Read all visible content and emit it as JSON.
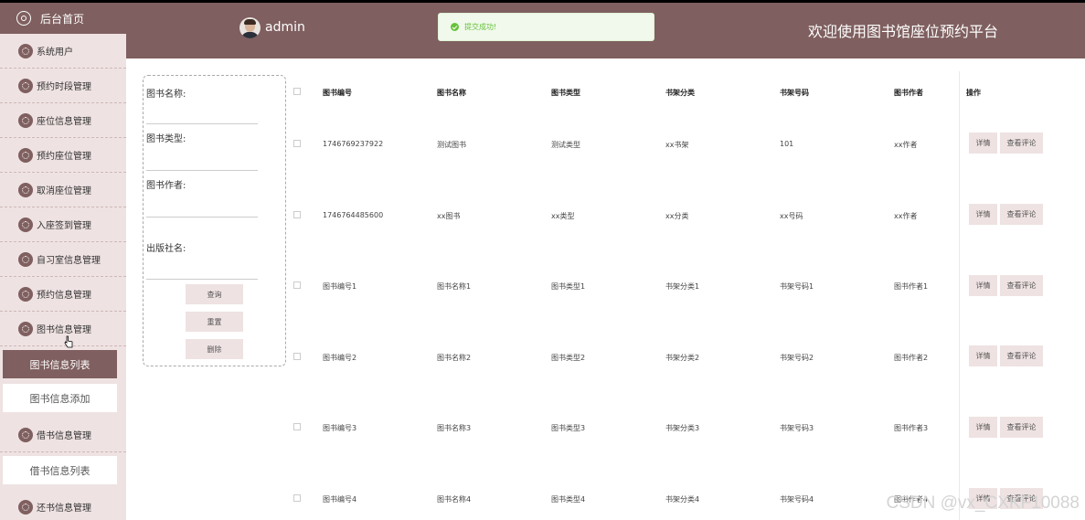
{
  "sidebar": {
    "home": "后台首页",
    "items": [
      {
        "label": "系统用户"
      },
      {
        "label": "预约时段管理"
      },
      {
        "label": "座位信息管理"
      },
      {
        "label": "预约座位管理"
      },
      {
        "label": "取消座位管理"
      },
      {
        "label": "入座签到管理"
      },
      {
        "label": "自习室信息管理"
      },
      {
        "label": "预约信息管理"
      },
      {
        "label": "图书信息管理"
      }
    ],
    "book_subs": [
      "图书信息列表",
      "图书信息添加"
    ],
    "borrow": "借书信息管理",
    "borrow_subs": [
      "借书信息列表"
    ],
    "return": "还书信息管理"
  },
  "header": {
    "user": "admin",
    "toast": "提交成功!",
    "title": "欢迎使用图书馆座位预约平台"
  },
  "search": {
    "fields": [
      "图书名称:",
      "图书类型:",
      "图书作者:",
      "出版社名:"
    ],
    "buttons": {
      "query": "查询",
      "reset": "重置",
      "delete": "删除"
    }
  },
  "table": {
    "headers": [
      "图书编号",
      "图书名称",
      "图书类型",
      "书架分类",
      "书架号码",
      "图书作者",
      "操作"
    ],
    "rows": [
      [
        "1746769237922",
        "测试图书",
        "测试类型",
        "xx书架",
        "101",
        "xx作者"
      ],
      [
        "1746764485600",
        "xx图书",
        "xx类型",
        "xx分类",
        "xx号码",
        "xx作者"
      ],
      [
        "图书编号1",
        "图书名称1",
        "图书类型1",
        "书架分类1",
        "书架号码1",
        "图书作者1"
      ],
      [
        "图书编号2",
        "图书名称2",
        "图书类型2",
        "书架分类2",
        "书架号码2",
        "图书作者2"
      ],
      [
        "图书编号3",
        "图书名称3",
        "图书类型3",
        "书架分类3",
        "书架号码3",
        "图书作者3"
      ],
      [
        "图书编号4",
        "图书名称4",
        "图书类型4",
        "书架分类4",
        "书架号码4",
        "图书作者4"
      ]
    ],
    "actions": {
      "detail": "详情",
      "comment": "查看评论"
    }
  },
  "watermark": "CSDN @vx_CXKF10088",
  "colors": {
    "primary": "#7f5f5f",
    "sidebar_bg": "#efe2e2",
    "toast_bg": "#f0f9eb",
    "toast_text": "#67c23a"
  }
}
